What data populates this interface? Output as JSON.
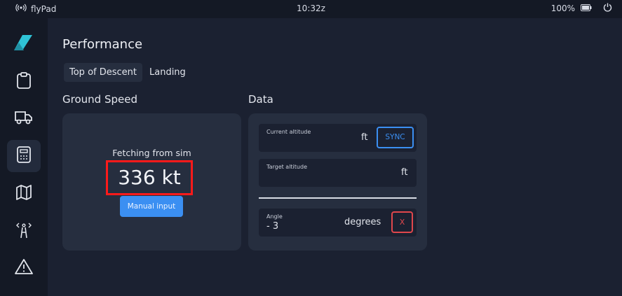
{
  "status_bar": {
    "app_name": "flyPad",
    "time": "10:32z",
    "battery": "100%",
    "icons": [
      "wifi-icon",
      "battery-icon",
      "power-icon"
    ]
  },
  "sidebar": {
    "items": [
      {
        "name": "logo",
        "icon": "logo-icon"
      },
      {
        "name": "dashboard",
        "icon": "clipboard-icon"
      },
      {
        "name": "dispatch",
        "icon": "truck-icon"
      },
      {
        "name": "performance",
        "icon": "calculator-icon",
        "active": true
      },
      {
        "name": "navigation",
        "icon": "map-icon"
      },
      {
        "name": "atc",
        "icon": "tower-icon"
      },
      {
        "name": "failures",
        "icon": "warning-icon"
      }
    ]
  },
  "page": {
    "title": "Performance",
    "tabs": [
      {
        "label": "Top of Descent",
        "active": true
      },
      {
        "label": "Landing",
        "active": false
      }
    ]
  },
  "ground_speed": {
    "section_title": "Ground Speed",
    "status_label": "Fetching from sim",
    "value": "336 kt",
    "manual_button": "Manual input"
  },
  "data": {
    "section_title": "Data",
    "current_altitude": {
      "label": "Current altitude",
      "unit": "ft",
      "sync_button": "SYNC"
    },
    "target_altitude": {
      "label": "Target altitude",
      "unit": "ft"
    },
    "angle": {
      "label": "Angle",
      "value": "- 3",
      "unit": "degrees",
      "clear_button": "X"
    }
  },
  "colors": {
    "background": "#1b2131",
    "sidebar": "#141925",
    "panel": "#262e3f",
    "accent_blue": "#3b8ff2",
    "highlight_red": "#ff1a1a",
    "danger_red": "#e0474c",
    "logo_teal": "#2fc3d6"
  }
}
